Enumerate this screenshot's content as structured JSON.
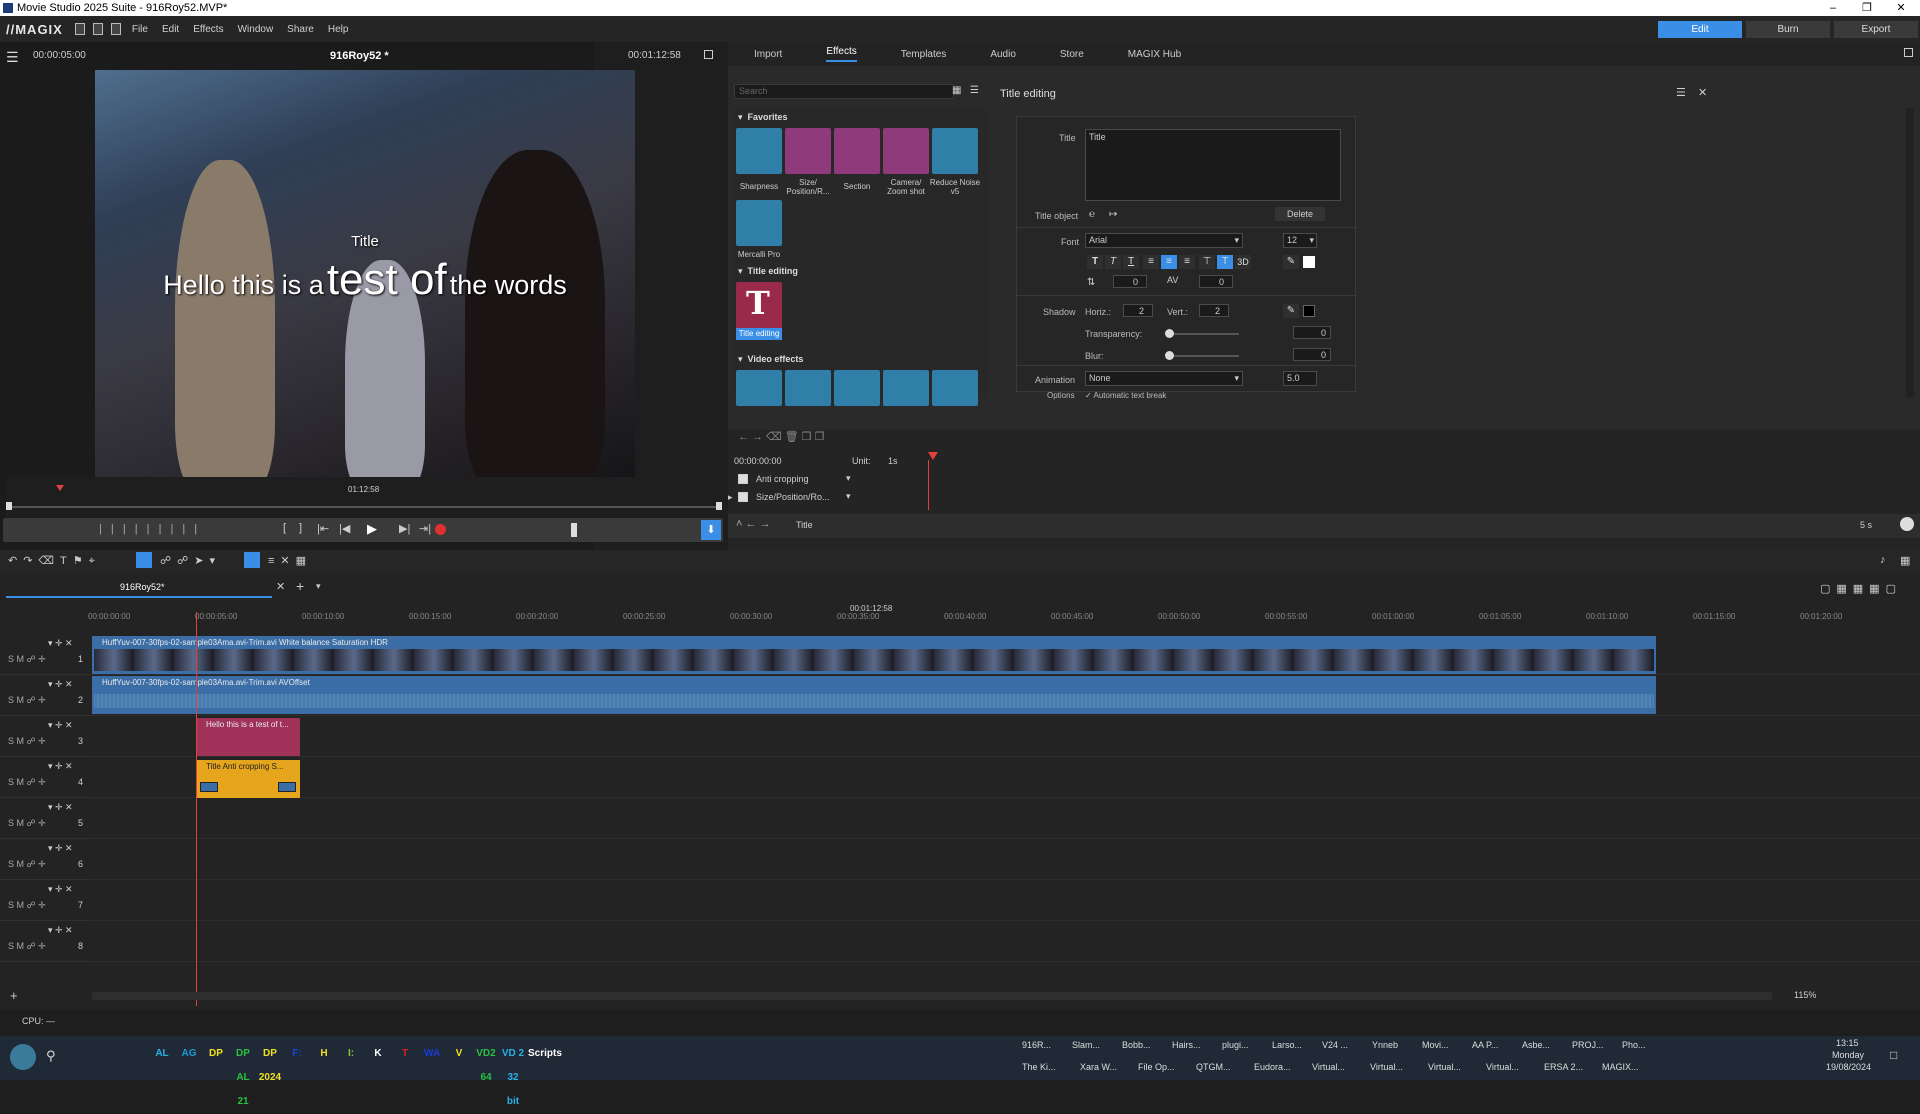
{
  "window": {
    "title": "Movie Studio 2025 Suite - 916Roy52.MVP*"
  },
  "menu": {
    "logo": "//MAGIX",
    "items": [
      "File",
      "Edit",
      "Effects",
      "Window",
      "Share",
      "Help"
    ]
  },
  "modes": {
    "edit": "Edit",
    "burn": "Burn",
    "export": "Export"
  },
  "preview": {
    "timecode_left": "00:00:05:00",
    "project": "916Roy52 *",
    "timecode_right": "00:01:12:58",
    "overlay_small": "Title",
    "overlay_line": [
      "Hello this is a",
      "test of",
      "the words"
    ],
    "scrub_time": "01:12:58"
  },
  "tabs": [
    "Import",
    "Effects",
    "Templates",
    "Audio",
    "Store",
    "MAGIX Hub"
  ],
  "effects": {
    "search_placeholder": "Search",
    "sections": {
      "favorites": "Favorites",
      "title_editing": "Title editing",
      "video_effects": "Video effects"
    },
    "favorites": [
      "Sharpness",
      "Size/ Position/R...",
      "Section",
      "Camera/ Zoom shot",
      "Reduce Noise v5",
      "Mercalli Pro"
    ],
    "title_tile": "Title editing"
  },
  "title_editor": {
    "header": "Title editing",
    "title_label": "Title",
    "title_value": "Title",
    "title_object_label": "Title object",
    "delete": "Delete",
    "font_label": "Font",
    "font_value": "Arial",
    "font_size": "12",
    "spacing_a": "0",
    "spacing_b": "0",
    "threeD": "3D",
    "shadow_label": "Shadow",
    "horiz_label": "Horiz.:",
    "horiz_value": "2",
    "vert_label": "Vert.:",
    "vert_value": "2",
    "transparency_label": "Transparency:",
    "transparency_value": "0",
    "blur_label": "Blur:",
    "blur_value": "0",
    "animation_label": "Animation",
    "animation_value": "None",
    "anim_number": "5.0",
    "options_label": "Options",
    "auto_break": "Automatic text break"
  },
  "keyframes": {
    "time": "00:00:00:00",
    "unit_label": "Unit:",
    "unit_value": "1s",
    "rows": [
      "Anti cropping",
      "Size/Position/Ro..."
    ],
    "footer": "Title",
    "zoom": "5 s"
  },
  "timeline": {
    "tab": "916Roy52*",
    "end_marker": "00:01:12:58",
    "ruler": [
      "00:00:00:00",
      "00:00:05:00",
      "00:00:10:00",
      "00:00:15:00",
      "00:00:20:00",
      "00:00:25:00",
      "00:00:30:00",
      "00:00:35:00",
      "00:00:40:00",
      "00:00:45:00",
      "00:00:50:00",
      "00:00:55:00",
      "00:01:00:00",
      "00:01:05:00",
      "00:01:10:00",
      "00:01:15:00",
      "00:01:20:00"
    ],
    "tracks": [
      "1",
      "2",
      "3",
      "4",
      "5",
      "6",
      "7",
      "8"
    ],
    "clip1": "HuffYuv-007-30fps-02-sample03Ama.avi-Trim.avi  White balance  Saturation  HDR",
    "clip2": "HuffYuv-007-30fps-02-sample03Ama.avi-Trim.avi  AVOffset",
    "clip3": "Hello this is a test of t...",
    "clip4": "Title  Anti cropping  S...",
    "zoom": "115%"
  },
  "status": {
    "cpu": "CPU: —"
  },
  "taskbar": {
    "icons": [
      "AL",
      "AG",
      "DP",
      "DP AL 21",
      "DP 2024",
      "F:",
      "H",
      "I:",
      "K",
      "T",
      "WA",
      "V",
      "VD2 64",
      "VD 2 32 bit",
      "Scripts"
    ],
    "windows_top": [
      "916R...",
      "Slam...",
      "Bobb...",
      "Hairs...",
      "plugi...",
      "Larso...",
      "V24 ...",
      "Ynneb",
      "Movi...",
      "AA P...",
      "Asbe...",
      "PROJ...",
      "Pho..."
    ],
    "windows_bottom": [
      "The Ki...",
      "Xara W...",
      "File Op...",
      "QTGM...",
      "Eudora...",
      "Virtual...",
      "Virtual...",
      "Virtual...",
      "Virtual...",
      "ERSA 2...",
      "MAGIX..."
    ],
    "clock_time": "13:15",
    "clock_day": "Monday",
    "clock_date": "19/08/2024"
  },
  "colors": {
    "accent": "#3a8ee6",
    "title_clip": "#a0325a",
    "title_fx_clip": "#e5a51c",
    "video_clip": "#3b6ea6",
    "title_tile": "#9a2a4a"
  }
}
